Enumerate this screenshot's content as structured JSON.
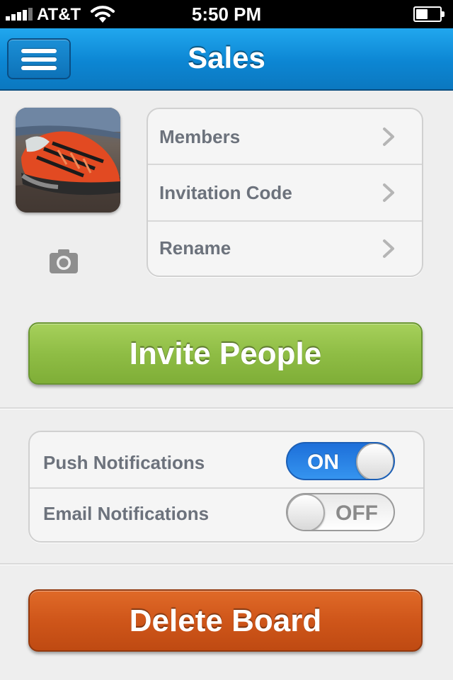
{
  "status_bar": {
    "carrier": "AT&T",
    "time": "5:50 PM"
  },
  "nav": {
    "title": "Sales"
  },
  "board_menu": {
    "items": [
      {
        "label": "Members"
      },
      {
        "label": "Invitation Code"
      },
      {
        "label": "Rename"
      }
    ]
  },
  "actions": {
    "invite_label": "Invite People",
    "delete_label": "Delete Board"
  },
  "notifications": {
    "push": {
      "label": "Push Notifications",
      "state": "ON"
    },
    "email": {
      "label": "Email Notifications",
      "state": "OFF"
    }
  },
  "colors": {
    "nav_blue": "#0c86d3",
    "invite_green": "#8fbd45",
    "delete_orange": "#cf561a",
    "toggle_on_blue": "#2a85e6"
  }
}
